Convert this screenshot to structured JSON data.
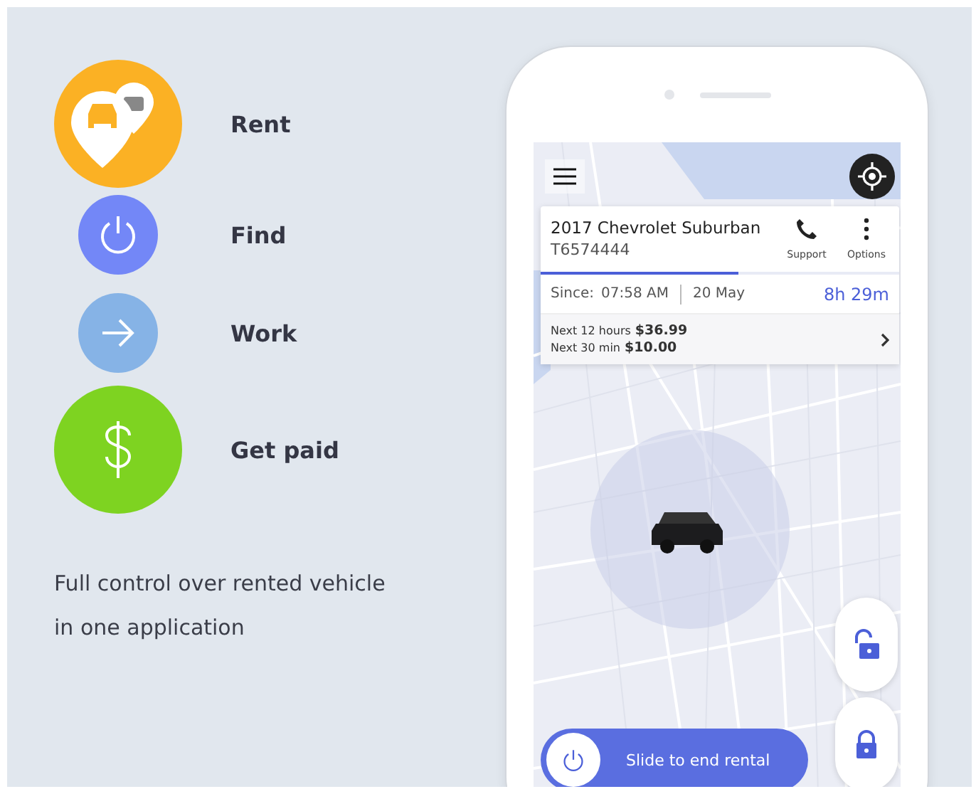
{
  "features": [
    {
      "kind": "rent",
      "label": "Rent",
      "color": "#fbb124"
    },
    {
      "kind": "find",
      "label": "Find",
      "color": "#7387f7"
    },
    {
      "kind": "work",
      "label": "Work",
      "color": "#86b3e6"
    },
    {
      "kind": "paid",
      "label": "Get paid",
      "color": "#7ed321"
    }
  ],
  "tagline": "Full control over rented vehicle in one application",
  "app": {
    "vehicle": {
      "name": "2017 Chevrolet Suburban",
      "plate": "T6574444"
    },
    "actions": [
      {
        "kind": "phone",
        "label": "Support"
      },
      {
        "kind": "more",
        "label": "Options"
      }
    ],
    "progress": {
      "level": 0.55
    },
    "since": {
      "label": "Since:",
      "time": "07:58 AM",
      "date": "20 May",
      "duration": "8h 29m"
    },
    "rates": [
      {
        "label": "Next 12 hours",
        "price": "$36.99"
      },
      {
        "label": "Next 30 min",
        "price": "$10.00"
      }
    ],
    "locks": [
      {
        "kind": "unlocked"
      },
      {
        "kind": "locked"
      }
    ],
    "slider": {
      "label": "Slide to end rental",
      "level": 0
    }
  }
}
